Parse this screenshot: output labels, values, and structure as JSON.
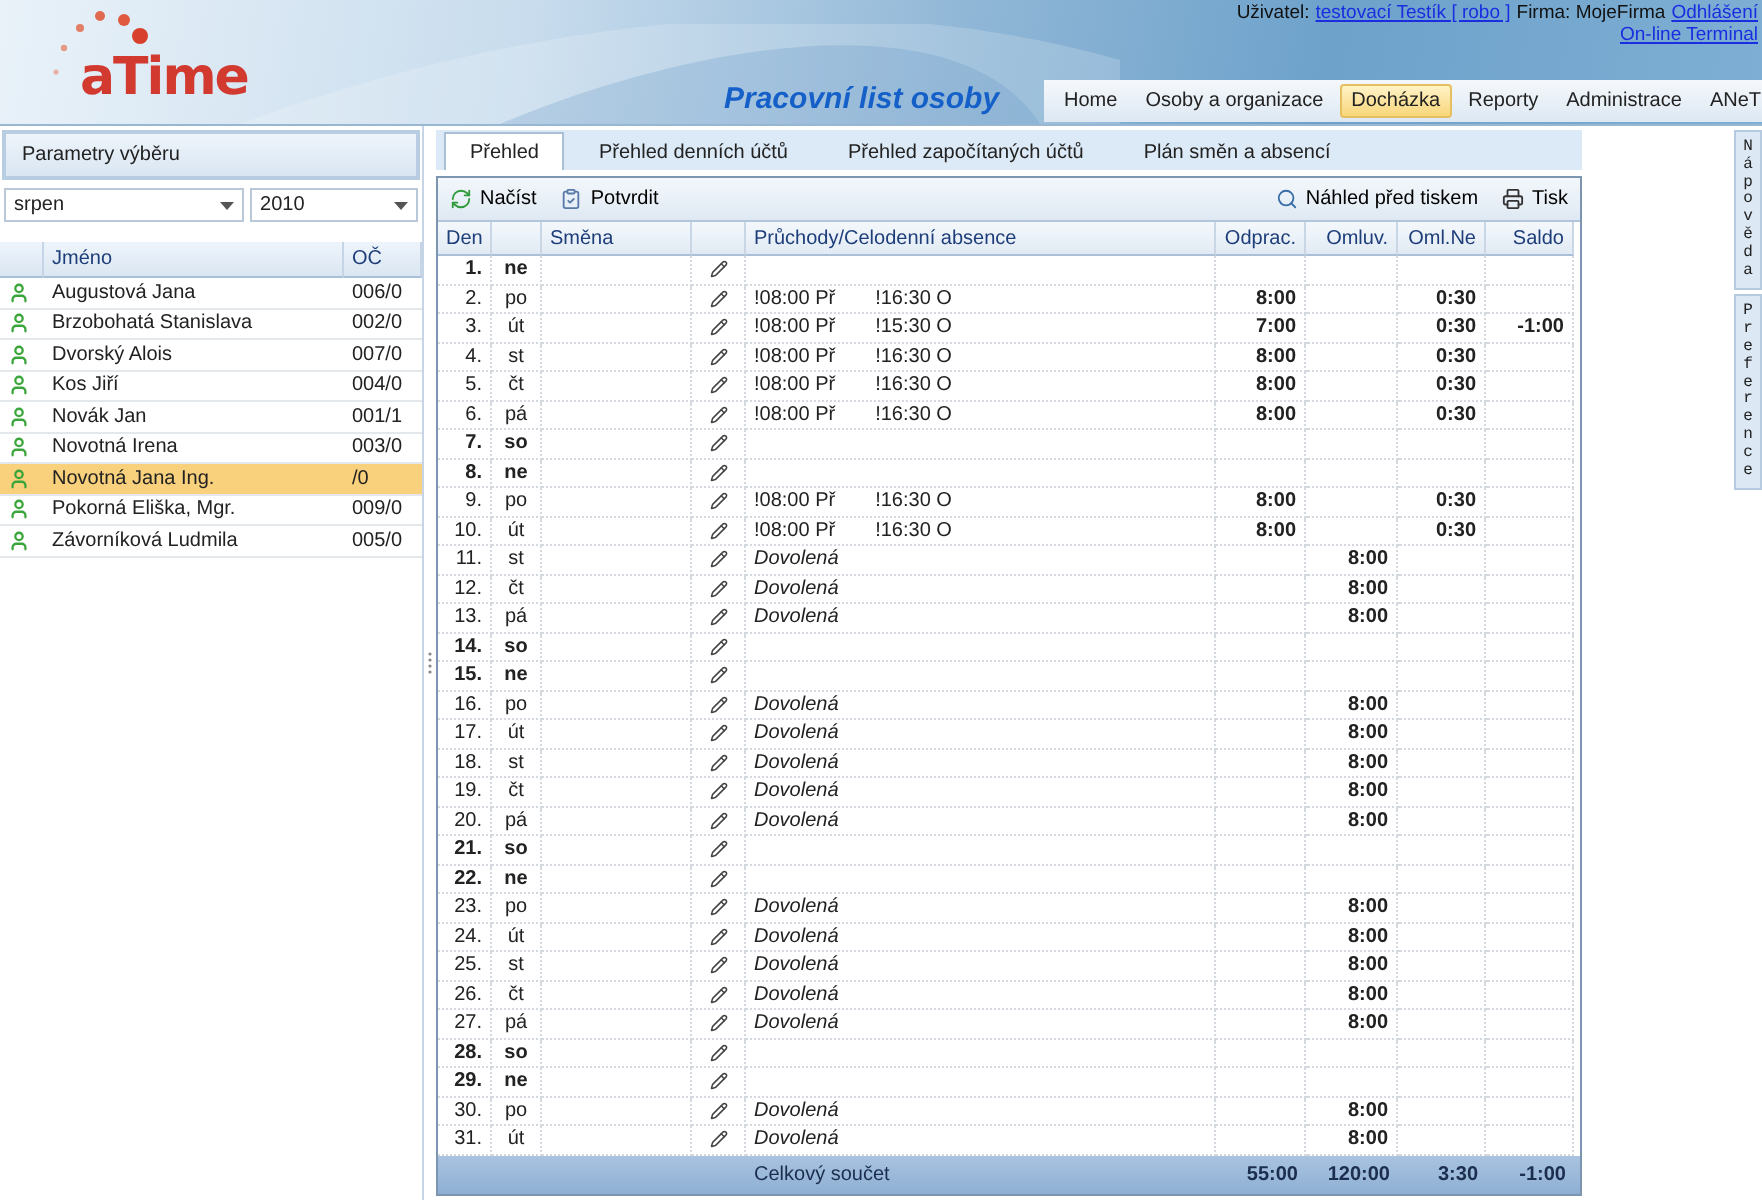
{
  "logo": {
    "text": "aTime"
  },
  "page_title": "Pracovní list osoby",
  "user_bar": {
    "user_label": "Uživatel:",
    "user": "testovací Testík [ robo ]",
    "company": "Firma: MojeFirma",
    "logout": "Odhlášení",
    "terminal": "On-line Terminal"
  },
  "nav": [
    {
      "label": "Home",
      "selected": false
    },
    {
      "label": "Osoby a organizace",
      "selected": false
    },
    {
      "label": "Docházka",
      "selected": true
    },
    {
      "label": "Reporty",
      "selected": false
    },
    {
      "label": "Administrace",
      "selected": false
    },
    {
      "label": "ANeT",
      "selected": false
    }
  ],
  "sidebar": {
    "title": "Parametry výběru",
    "month": "srpen",
    "year": "2010",
    "columns": [
      "Jméno",
      "OČ"
    ],
    "people": [
      {
        "name": "Augustová Jana",
        "id": "006/0",
        "selected": false
      },
      {
        "name": "Brzobohatá Stanislava",
        "id": "002/0",
        "selected": false
      },
      {
        "name": "Dvorský Alois",
        "id": "007/0",
        "selected": false
      },
      {
        "name": "Kos Jiří",
        "id": "004/0",
        "selected": false
      },
      {
        "name": "Novák Jan",
        "id": "001/1",
        "selected": false
      },
      {
        "name": "Novotná Irena",
        "id": "003/0",
        "selected": false
      },
      {
        "name": "Novotná Jana Ing.",
        "id": "/0",
        "selected": true
      },
      {
        "name": "Pokorná Eliška, Mgr.",
        "id": "009/0",
        "selected": false
      },
      {
        "name": "Závorníková Ludmila",
        "id": "005/0",
        "selected": false
      }
    ]
  },
  "tabs": [
    {
      "label": "Přehled",
      "selected": true
    },
    {
      "label": "Přehled denních účtů",
      "selected": false
    },
    {
      "label": "Přehled započítaných účtů",
      "selected": false
    },
    {
      "label": "Plán směn a absencí",
      "selected": false
    }
  ],
  "toolbar": {
    "load": "Načíst",
    "confirm": "Potvrdit",
    "preview": "Náhled před tiskem",
    "print": "Tisk"
  },
  "side_tabs": [
    "Nápověda",
    "Preference"
  ],
  "table": {
    "columns": [
      "Den",
      "Směna",
      "Průchody/Celodenní absence",
      "Odprac.",
      "Omluv.",
      "Oml.Ne",
      "Saldo"
    ],
    "rows": [
      {
        "day": "1.",
        "weekday": "ne",
        "weekend": true
      },
      {
        "day": "2.",
        "weekday": "po",
        "weekend": false,
        "kind": "passes",
        "in": "!08:00 Př",
        "out": "!16:30 O",
        "worked": "8:00",
        "unexcused": "0:30"
      },
      {
        "day": "3.",
        "weekday": "út",
        "weekend": false,
        "kind": "passes",
        "in": "!08:00 Př",
        "out": "!15:30 O",
        "worked": "7:00",
        "unexcused": "0:30",
        "balance": "-1:00"
      },
      {
        "day": "4.",
        "weekday": "st",
        "weekend": false,
        "kind": "passes",
        "in": "!08:00 Př",
        "out": "!16:30 O",
        "worked": "8:00",
        "unexcused": "0:30"
      },
      {
        "day": "5.",
        "weekday": "čt",
        "weekend": false,
        "kind": "passes",
        "in": "!08:00 Př",
        "out": "!16:30 O",
        "worked": "8:00",
        "unexcused": "0:30"
      },
      {
        "day": "6.",
        "weekday": "pá",
        "weekend": false,
        "kind": "passes",
        "in": "!08:00 Př",
        "out": "!16:30 O",
        "worked": "8:00",
        "unexcused": "0:30"
      },
      {
        "day": "7.",
        "weekday": "so",
        "weekend": true
      },
      {
        "day": "8.",
        "weekday": "ne",
        "weekend": true
      },
      {
        "day": "9.",
        "weekday": "po",
        "weekend": false,
        "kind": "passes",
        "in": "!08:00 Př",
        "out": "!16:30 O",
        "worked": "8:00",
        "unexcused": "0:30"
      },
      {
        "day": "10.",
        "weekday": "út",
        "weekend": false,
        "kind": "passes",
        "in": "!08:00 Př",
        "out": "!16:30 O",
        "worked": "8:00",
        "unexcused": "0:30"
      },
      {
        "day": "11.",
        "weekday": "st",
        "weekend": false,
        "kind": "absence",
        "absence": "Dovolená",
        "excused": "8:00"
      },
      {
        "day": "12.",
        "weekday": "čt",
        "weekend": false,
        "kind": "absence",
        "absence": "Dovolená",
        "excused": "8:00"
      },
      {
        "day": "13.",
        "weekday": "pá",
        "weekend": false,
        "kind": "absence",
        "absence": "Dovolená",
        "excused": "8:00"
      },
      {
        "day": "14.",
        "weekday": "so",
        "weekend": true
      },
      {
        "day": "15.",
        "weekday": "ne",
        "weekend": true
      },
      {
        "day": "16.",
        "weekday": "po",
        "weekend": false,
        "kind": "absence",
        "absence": "Dovolená",
        "excused": "8:00"
      },
      {
        "day": "17.",
        "weekday": "út",
        "weekend": false,
        "kind": "absence",
        "absence": "Dovolená",
        "excused": "8:00"
      },
      {
        "day": "18.",
        "weekday": "st",
        "weekend": false,
        "kind": "absence",
        "absence": "Dovolená",
        "excused": "8:00"
      },
      {
        "day": "19.",
        "weekday": "čt",
        "weekend": false,
        "kind": "absence",
        "absence": "Dovolená",
        "excused": "8:00"
      },
      {
        "day": "20.",
        "weekday": "pá",
        "weekend": false,
        "kind": "absence",
        "absence": "Dovolená",
        "excused": "8:00"
      },
      {
        "day": "21.",
        "weekday": "so",
        "weekend": true
      },
      {
        "day": "22.",
        "weekday": "ne",
        "weekend": true
      },
      {
        "day": "23.",
        "weekday": "po",
        "weekend": false,
        "kind": "absence",
        "absence": "Dovolená",
        "excused": "8:00"
      },
      {
        "day": "24.",
        "weekday": "út",
        "weekend": false,
        "kind": "absence",
        "absence": "Dovolená",
        "excused": "8:00"
      },
      {
        "day": "25.",
        "weekday": "st",
        "weekend": false,
        "kind": "absence",
        "absence": "Dovolená",
        "excused": "8:00"
      },
      {
        "day": "26.",
        "weekday": "čt",
        "weekend": false,
        "kind": "absence",
        "absence": "Dovolená",
        "excused": "8:00"
      },
      {
        "day": "27.",
        "weekday": "pá",
        "weekend": false,
        "kind": "absence",
        "absence": "Dovolená",
        "excused": "8:00"
      },
      {
        "day": "28.",
        "weekday": "so",
        "weekend": true
      },
      {
        "day": "29.",
        "weekday": "ne",
        "weekend": true
      },
      {
        "day": "30.",
        "weekday": "po",
        "weekend": false,
        "kind": "absence",
        "absence": "Dovolená",
        "excused": "8:00"
      },
      {
        "day": "31.",
        "weekday": "út",
        "weekend": false,
        "kind": "absence",
        "absence": "Dovolená",
        "excused": "8:00"
      }
    ],
    "total": {
      "label": "Celkový součet",
      "worked": "55:00",
      "excused": "120:00",
      "unexcused": "3:30",
      "balance": "-1:00"
    }
  }
}
